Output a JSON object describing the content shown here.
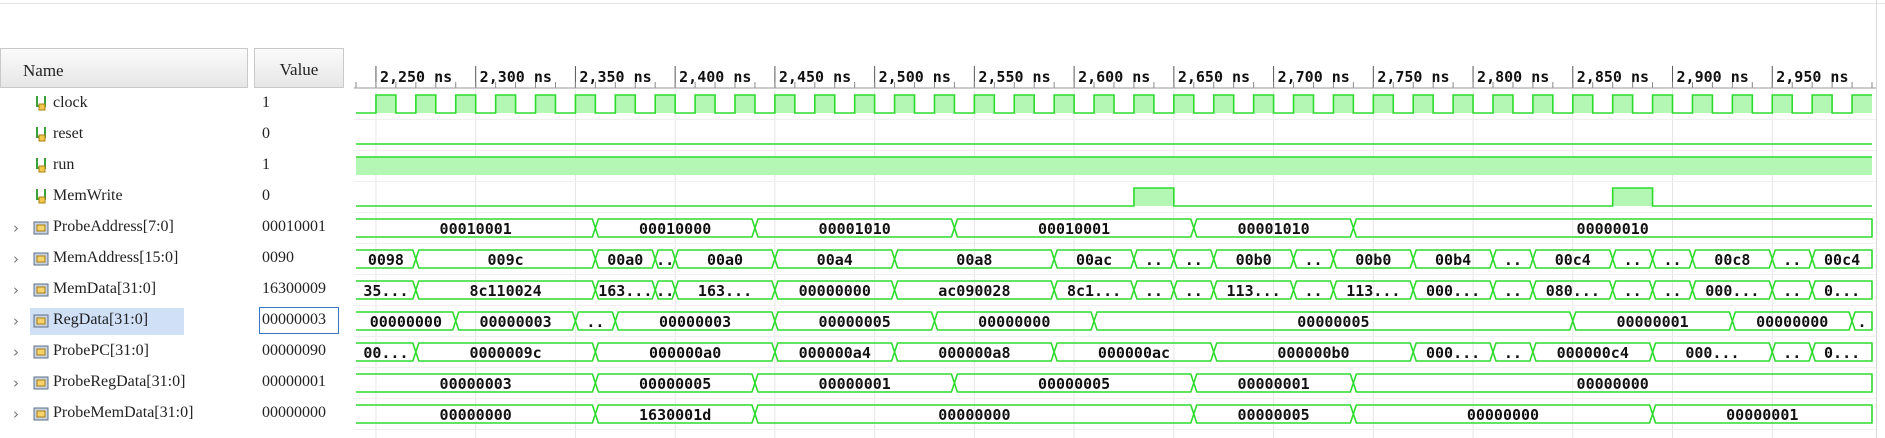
{
  "columns": {
    "name": "Name",
    "value": "Value"
  },
  "time_axis": {
    "unit": "ns",
    "tick_labels": [
      "2,250 ns",
      "2,300 ns",
      "2,350 ns",
      "2,400 ns",
      "2,450 ns",
      "2,500 ns",
      "2,550 ns",
      "2,600 ns",
      "2,650 ns",
      "2,700 ns",
      "2,750 ns",
      "2,800 ns",
      "2,850 ns",
      "2,900 ns",
      "2,950 ns"
    ],
    "view_range_ns": [
      2240,
      3000
    ]
  },
  "colors": {
    "wave": "#2ddb2d",
    "high_fill": "#b4f7b4",
    "selection": "#cfe0f7",
    "value_box": "#3a76c4",
    "grid": "#e6e6e6"
  },
  "selected_signal": "RegData[31:0]",
  "signals": [
    {
      "name": "clock",
      "value": "1",
      "type": "scalar",
      "clock": {
        "period_ns": 20,
        "first_rise_ns": 2250
      }
    },
    {
      "name": "reset",
      "value": "0",
      "type": "scalar",
      "segments": [
        {
          "start": 2240,
          "level": 0
        }
      ]
    },
    {
      "name": "run",
      "value": "1",
      "type": "scalar",
      "segments": [
        {
          "start": 2240,
          "level": 1
        }
      ]
    },
    {
      "name": "MemWrite",
      "value": "0",
      "type": "scalar",
      "segments": [
        {
          "start": 2240,
          "level": 0
        },
        {
          "start": 2630,
          "level": 1
        },
        {
          "start": 2650,
          "level": 0
        },
        {
          "start": 2870,
          "level": 1
        },
        {
          "start": 2890,
          "level": 0
        }
      ]
    },
    {
      "name": "ProbeAddress[7:0]",
      "value": "00010001",
      "type": "bus",
      "segments": [
        {
          "start": 2240,
          "label": "00010001"
        },
        {
          "start": 2360,
          "label": "00010000"
        },
        {
          "start": 2440,
          "label": "00001010"
        },
        {
          "start": 2540,
          "label": "00010001"
        },
        {
          "start": 2660,
          "label": "00001010"
        },
        {
          "start": 2740,
          "label": "00000010"
        }
      ]
    },
    {
      "name": "MemAddress[15:0]",
      "value": "0090",
      "type": "bus",
      "segments": [
        {
          "start": 2240,
          "label": "0098"
        },
        {
          "start": 2270,
          "label": "009c"
        },
        {
          "start": 2360,
          "label": "00a0"
        },
        {
          "start": 2390,
          "label": ".."
        },
        {
          "start": 2400,
          "label": "00a0"
        },
        {
          "start": 2450,
          "label": "00a4"
        },
        {
          "start": 2510,
          "label": "00a8"
        },
        {
          "start": 2590,
          "label": "00ac"
        },
        {
          "start": 2630,
          "label": ".."
        },
        {
          "start": 2650,
          "label": ".."
        },
        {
          "start": 2670,
          "label": "00b0"
        },
        {
          "start": 2710,
          "label": ".."
        },
        {
          "start": 2730,
          "label": "00b0"
        },
        {
          "start": 2770,
          "label": "00b4"
        },
        {
          "start": 2810,
          "label": ".."
        },
        {
          "start": 2830,
          "label": "00c4"
        },
        {
          "start": 2870,
          "label": ".."
        },
        {
          "start": 2890,
          "label": ".."
        },
        {
          "start": 2910,
          "label": "00c8"
        },
        {
          "start": 2950,
          "label": ".."
        },
        {
          "start": 2970,
          "label": "00c4"
        }
      ]
    },
    {
      "name": "MemData[31:0]",
      "value": "16300009",
      "type": "bus",
      "segments": [
        {
          "start": 2240,
          "label": "35..."
        },
        {
          "start": 2270,
          "label": "8c110024"
        },
        {
          "start": 2360,
          "label": "163..."
        },
        {
          "start": 2390,
          "label": ".."
        },
        {
          "start": 2400,
          "label": "163..."
        },
        {
          "start": 2450,
          "label": "00000000"
        },
        {
          "start": 2510,
          "label": "ac090028"
        },
        {
          "start": 2590,
          "label": "8c1..."
        },
        {
          "start": 2630,
          "label": ".."
        },
        {
          "start": 2650,
          "label": ".."
        },
        {
          "start": 2670,
          "label": "113..."
        },
        {
          "start": 2710,
          "label": ".."
        },
        {
          "start": 2730,
          "label": "113..."
        },
        {
          "start": 2770,
          "label": "000..."
        },
        {
          "start": 2810,
          "label": ".."
        },
        {
          "start": 2830,
          "label": "080..."
        },
        {
          "start": 2870,
          "label": ".."
        },
        {
          "start": 2890,
          "label": ".."
        },
        {
          "start": 2910,
          "label": "000..."
        },
        {
          "start": 2950,
          "label": ".."
        },
        {
          "start": 2970,
          "label": "0..."
        }
      ]
    },
    {
      "name": "RegData[31:0]",
      "value": "00000003",
      "type": "bus",
      "segments": [
        {
          "start": 2240,
          "label": "00000000"
        },
        {
          "start": 2290,
          "label": "00000003"
        },
        {
          "start": 2350,
          "label": ".."
        },
        {
          "start": 2370,
          "label": "00000003"
        },
        {
          "start": 2450,
          "label": "00000005"
        },
        {
          "start": 2530,
          "label": "00000000"
        },
        {
          "start": 2610,
          "label": "00000005"
        },
        {
          "start": 2850,
          "label": "00000001"
        },
        {
          "start": 2930,
          "label": "00000000"
        },
        {
          "start": 2990,
          "label": "."
        }
      ]
    },
    {
      "name": "ProbePC[31:0]",
      "value": "00000090",
      "type": "bus",
      "segments": [
        {
          "start": 2240,
          "label": "00..."
        },
        {
          "start": 2270,
          "label": "0000009c"
        },
        {
          "start": 2360,
          "label": "000000a0"
        },
        {
          "start": 2450,
          "label": "000000a4"
        },
        {
          "start": 2510,
          "label": "000000a8"
        },
        {
          "start": 2590,
          "label": "000000ac"
        },
        {
          "start": 2670,
          "label": "000000b0"
        },
        {
          "start": 2770,
          "label": "000..."
        },
        {
          "start": 2810,
          "label": ".."
        },
        {
          "start": 2830,
          "label": "000000c4"
        },
        {
          "start": 2890,
          "label": "000..."
        },
        {
          "start": 2950,
          "label": ".."
        },
        {
          "start": 2970,
          "label": "0..."
        }
      ]
    },
    {
      "name": "ProbeRegData[31:0]",
      "value": "00000001",
      "type": "bus",
      "segments": [
        {
          "start": 2240,
          "label": "00000003"
        },
        {
          "start": 2360,
          "label": "00000005"
        },
        {
          "start": 2440,
          "label": "00000001"
        },
        {
          "start": 2540,
          "label": "00000005"
        },
        {
          "start": 2660,
          "label": "00000001"
        },
        {
          "start": 2740,
          "label": "00000000"
        }
      ]
    },
    {
      "name": "ProbeMemData[31:0]",
      "value": "00000000",
      "type": "bus",
      "segments": [
        {
          "start": 2240,
          "label": "00000000"
        },
        {
          "start": 2360,
          "label": "1630001d"
        },
        {
          "start": 2440,
          "label": "00000000"
        },
        {
          "start": 2660,
          "label": "00000005"
        },
        {
          "start": 2740,
          "label": "00000000"
        },
        {
          "start": 2890,
          "label": "00000001"
        }
      ]
    }
  ]
}
